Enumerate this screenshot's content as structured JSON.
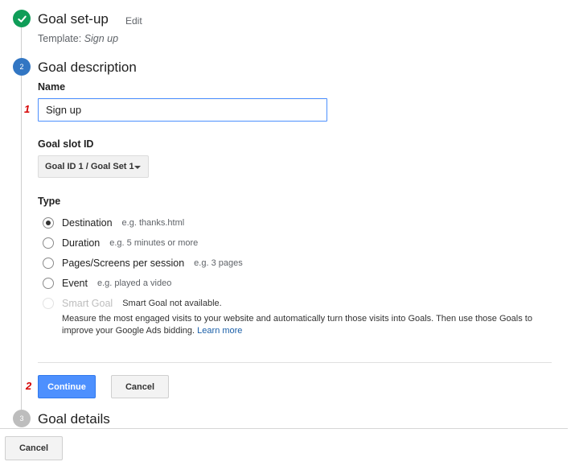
{
  "steps": {
    "setup": {
      "number": "✓",
      "title": "Goal set-up",
      "edit_label": "Edit",
      "template_prefix": "Template:",
      "template_name": "Sign up"
    },
    "description": {
      "number": "2",
      "title": "Goal description"
    },
    "details": {
      "number": "3",
      "title": "Goal details"
    }
  },
  "form": {
    "name_label": "Name",
    "name_value": "Sign up",
    "marker_1": "1",
    "slot_label": "Goal slot ID",
    "slot_value": "Goal ID 1 / Goal Set 1",
    "type_label": "Type",
    "types": [
      {
        "label": "Destination",
        "hint": "e.g. thanks.html",
        "checked": true
      },
      {
        "label": "Duration",
        "hint": "e.g. 5 minutes or more",
        "checked": false
      },
      {
        "label": "Pages/Screens per session",
        "hint": "e.g. 3 pages",
        "checked": false
      },
      {
        "label": "Event",
        "hint": "e.g. played a video",
        "checked": false
      },
      {
        "label": "Smart Goal",
        "hint": "Smart Goal not available.",
        "checked": false,
        "disabled": true
      }
    ],
    "smart_desc": "Measure the most engaged visits to your website and automatically turn those visits into Goals. Then use those Goals to improve your Google Ads bidding.",
    "learn_more": "Learn more",
    "marker_2": "2",
    "continue_label": "Continue",
    "cancel_label": "Cancel"
  },
  "footer": {
    "cancel_label": "Cancel"
  },
  "colors": {
    "done": "#0f9d58",
    "active": "#3276c3",
    "pending": "#bdbdbd",
    "primary": "#4d90fe",
    "link": "#1a5fa8",
    "marker": "#d50000"
  }
}
